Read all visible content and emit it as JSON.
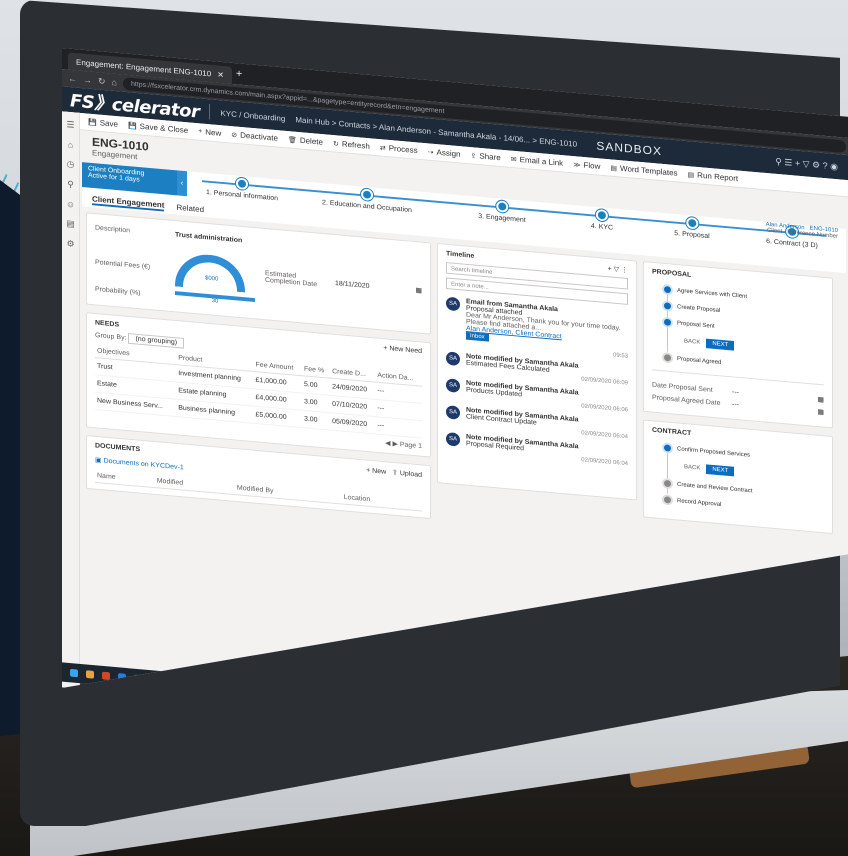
{
  "browser": {
    "tab_label": "Engagement: Engagement ENG-1010",
    "url": "https://fsxcelerator.crm.dynamics.com/main.aspx?appid=...&pagetype=entityrecord&etn=engagement"
  },
  "app": {
    "logo": "FS》celerator",
    "area": "KYC / Onboarding",
    "crumb": "Main Hub  >  Contacts  >  Alan Anderson - Samantha Akala - 14/06...  >  ENG-1010",
    "environment": "SANDBOX",
    "header_icons": "⚲  ☰  +  ▽  ⚙  ?  ◉"
  },
  "commands": [
    "Save",
    "Save & Close",
    "New",
    "Deactivate",
    "Delete",
    "Refresh",
    "Process",
    "Assign",
    "Share",
    "Email a Link",
    "Flow",
    "Word Templates",
    "Run Report"
  ],
  "record": {
    "title": "ENG-1010",
    "subtitle": "Engagement"
  },
  "bpf": {
    "active_title": "Client Onboarding",
    "active_sub": "Active for 1 days",
    "stages": [
      "1. Personal information",
      "2. Education and Occupation",
      "3. Engagement",
      "4. KYC",
      "5. Proposal",
      "6. Contract (3 D)"
    ],
    "owner_name": "Alan Anderson",
    "owner_role": "Client",
    "ref": "ENG-1010",
    "ref_label": "Reference Number"
  },
  "tabs": [
    "Client Engagement",
    "Related"
  ],
  "summary": {
    "description_label": "Description",
    "description_value": "Trust administration",
    "fees_label": "Potential Fees (€)",
    "fees_value": "$000",
    "completion_label": "Estimated Completion Date",
    "completion_value": "18/11/2020",
    "probability_label": "Probability (%)",
    "probability_value": "30"
  },
  "needs": {
    "title": "NEEDS",
    "new_record": "New Need",
    "group_by_label": "Group By:",
    "group_by_value": "(no grouping)",
    "columns": [
      "Objectives",
      "Product",
      "Fee Amount",
      "Fee %",
      "Create D...",
      "Action Da..."
    ],
    "rows": [
      {
        "objective": "Trust",
        "product": "Investment planning",
        "amount": "£1,000.00",
        "fee": "5.00",
        "date": "24/09/2020",
        "action": "---"
      },
      {
        "objective": "Estate",
        "product": "Estate planning",
        "amount": "£4,000.00",
        "fee": "3.00",
        "date": "07/10/2020",
        "action": "---"
      },
      {
        "objective": "New Business Serv...",
        "product": "Business planning",
        "amount": "£5,000.00",
        "fee": "3.00",
        "date": "05/09/2020",
        "action": "---"
      }
    ],
    "page": "Page 1"
  },
  "documents": {
    "title": "DOCUMENTS",
    "new_label": "New",
    "upload_label": "Upload",
    "library": "Documents on KYCDev-1",
    "columns": [
      "Name",
      "Modified",
      "Modified By",
      "Location"
    ]
  },
  "timeline": {
    "title": "Timeline",
    "search_placeholder": "Search timeline",
    "note_placeholder": "Enter a note...",
    "items": [
      {
        "initials": "SA",
        "title": "Email from Samantha Akala",
        "line1": "Proposal attached",
        "line2": "Dear Mr Anderson, Thank you for your time today. Please find attached a...",
        "link": "Alan Anderson, Client Contract",
        "date": "09:53"
      },
      {
        "initials": "SA",
        "title": "Note modified by Samantha Akala",
        "line1": "Estimated Fees Calculated",
        "line2": "",
        "link": "",
        "date": "02/09/2020 06:09"
      },
      {
        "initials": "SA",
        "title": "Note modified by Samantha Akala",
        "line1": "Products Updated",
        "line2": "",
        "link": "",
        "date": "02/09/2020 06:06"
      },
      {
        "initials": "SA",
        "title": "Note modified by Samantha Akala",
        "line1": "Client Contract Update",
        "line2": "",
        "link": "",
        "date": "02/09/2020 06:04"
      },
      {
        "initials": "SA",
        "title": "Note modified by Samantha Akala",
        "line1": "Proposal Required",
        "line2": "",
        "link": "",
        "date": "02/09/2020 06:04"
      }
    ],
    "inbox_badge": "Inbox"
  },
  "proposal": {
    "title": "PROPOSAL",
    "steps": [
      "Agree Services with Client",
      "Create Proposal",
      "Proposal Sent",
      "Proposal Agreed"
    ],
    "back": "BACK",
    "next": "NEXT",
    "sent_label": "Date Proposal Sent",
    "agreed_label": "Proposal Agreed Date",
    "empty": "---"
  },
  "contract": {
    "title": "CONTRACT",
    "steps": [
      "Confirm Proposed Services",
      "Create and Review Contract",
      "Record Approval"
    ],
    "back": "BACK",
    "next": "NEXT"
  },
  "colors": {
    "accent": "#0f6cbd",
    "header": "#1d2a3a",
    "bpf": "#1b7fc1"
  }
}
